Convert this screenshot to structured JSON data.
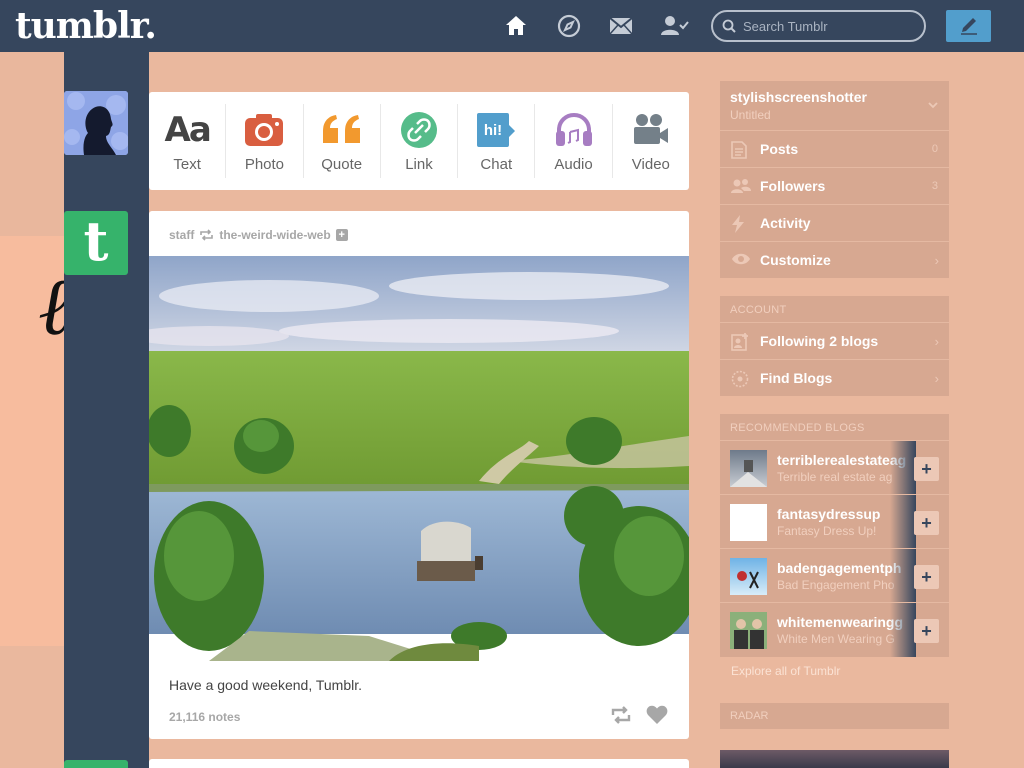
{
  "topbar": {
    "logo": "tumblr.",
    "search_placeholder": "Search Tumblr",
    "icons": [
      "home-icon",
      "explore-icon",
      "inbox-icon",
      "account-icon",
      "compose-icon"
    ]
  },
  "colors": {
    "topbar": "#36465d",
    "background": "#eab89e",
    "compose": "#529ecc",
    "staff_green": "#36b36b",
    "sidebar_block": "#d7a891"
  },
  "post_types": [
    {
      "label": "Text",
      "color": "#444444"
    },
    {
      "label": "Photo",
      "color": "#d95e40"
    },
    {
      "label": "Quote",
      "color": "#f2992e"
    },
    {
      "label": "Link",
      "color": "#56bc8a"
    },
    {
      "label": "Chat",
      "color": "#529ecc"
    },
    {
      "label": "Audio",
      "color": "#a77dc2"
    },
    {
      "label": "Video",
      "color": "#748089"
    }
  ],
  "post": {
    "author": "staff",
    "reblogged_from": "the-weird-wide-web",
    "caption": "Have a good weekend, Tumblr.",
    "notes": "21,116 notes"
  },
  "sidebar": {
    "blog": {
      "name": "stylishscreenshotter",
      "title": "Untitled"
    },
    "menu": [
      {
        "label": "Posts",
        "count": "0",
        "icon": "posts-icon"
      },
      {
        "label": "Followers",
        "count": "3",
        "icon": "followers-icon"
      },
      {
        "label": "Activity",
        "count": "",
        "icon": "activity-icon"
      },
      {
        "label": "Customize",
        "count": "",
        "icon": "customize-icon"
      }
    ],
    "account": {
      "heading": "ACCOUNT",
      "items": [
        {
          "label": "Following 2 blogs",
          "icon": "following-icon"
        },
        {
          "label": "Find Blogs",
          "icon": "find-blogs-icon"
        }
      ]
    },
    "recommended": {
      "heading": "RECOMMENDED BLOGS",
      "blogs": [
        {
          "name": "terriblerealestateag",
          "title": "Terrible real estate ag"
        },
        {
          "name": "fantasydressup",
          "title": "Fantasy Dress Up!"
        },
        {
          "name": "badengagementph",
          "title": "Bad Engagement Pho"
        },
        {
          "name": "whitemenwearingg",
          "title": "White Men Wearing G"
        }
      ],
      "explore": "Explore all of Tumblr"
    },
    "radar": {
      "heading": "RADAR"
    }
  }
}
